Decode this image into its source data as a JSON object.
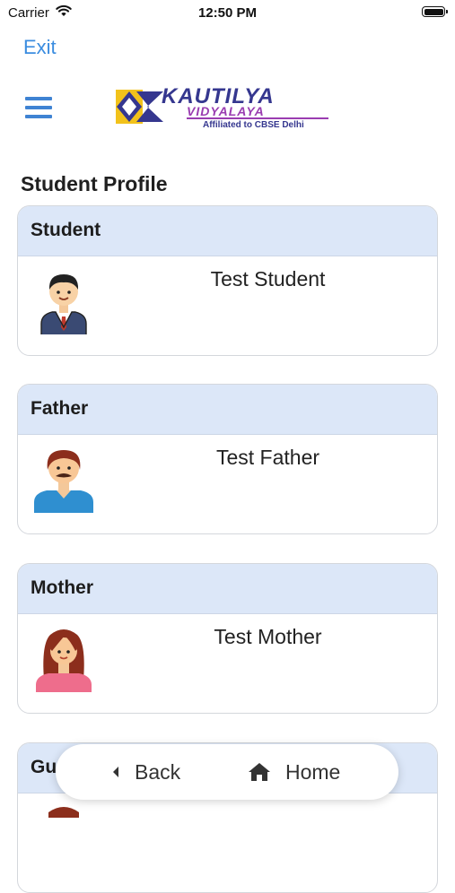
{
  "status_bar": {
    "carrier": "Carrier",
    "time": "12:50 PM"
  },
  "header": {
    "exit_label": "Exit",
    "logo": {
      "main": "KAUTILYA",
      "sub": "VIDYALAYA",
      "tagline": "Affiliated to CBSE Delhi"
    }
  },
  "page_title": "Student Profile",
  "cards": [
    {
      "label": "Student",
      "name": "Test Student"
    },
    {
      "label": "Father",
      "name": "Test Father"
    },
    {
      "label": "Mother",
      "name": "Test Mother"
    },
    {
      "label": "Gu",
      "name": ""
    }
  ],
  "bottom_nav": {
    "back_label": "Back",
    "home_label": "Home"
  },
  "colors": {
    "accent": "#3b8de0",
    "card_header": "#dce7f8",
    "logo_blue": "#35378f",
    "logo_purple": "#9a3db1"
  }
}
